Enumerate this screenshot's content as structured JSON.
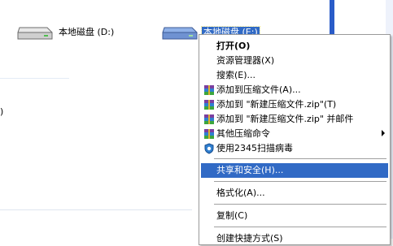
{
  "drives": [
    {
      "label": "本地磁盘 (D:)",
      "icon": "hard-drive-icon",
      "selected": false
    },
    {
      "label": "本地磁盘 (E:)",
      "icon": "hard-drive-icon",
      "selected": true
    }
  ],
  "left_fragment": ")",
  "context_menu": {
    "items": [
      {
        "label": "打开(O)",
        "bold": true
      },
      {
        "label": "资源管理器(X)"
      },
      {
        "label": "搜索(E)..."
      },
      {
        "label": "添加到压缩文件(A)...",
        "icon": "winrar-archive-icon"
      },
      {
        "label": "添加到 \"新建压缩文件.zip\"(T)",
        "icon": "winrar-archive-icon"
      },
      {
        "label": "添加到 \"新建压缩文件.zip\" 并邮件",
        "icon": "winrar-archive-icon"
      },
      {
        "label": "其他压缩命令",
        "icon": "winrar-archive-icon",
        "submenu": true
      },
      {
        "label": "使用2345扫描病毒",
        "icon": "shield-icon"
      },
      {
        "label": "共享和安全(H)...",
        "highlighted": true
      },
      {
        "label": "格式化(A)..."
      },
      {
        "label": "复制(C)"
      },
      {
        "label": "创建快捷方式(S)"
      }
    ]
  },
  "colors": {
    "selection": "#316ac5",
    "taskpane": "#2a5cc8",
    "menu_border": "#9a9a9a"
  }
}
